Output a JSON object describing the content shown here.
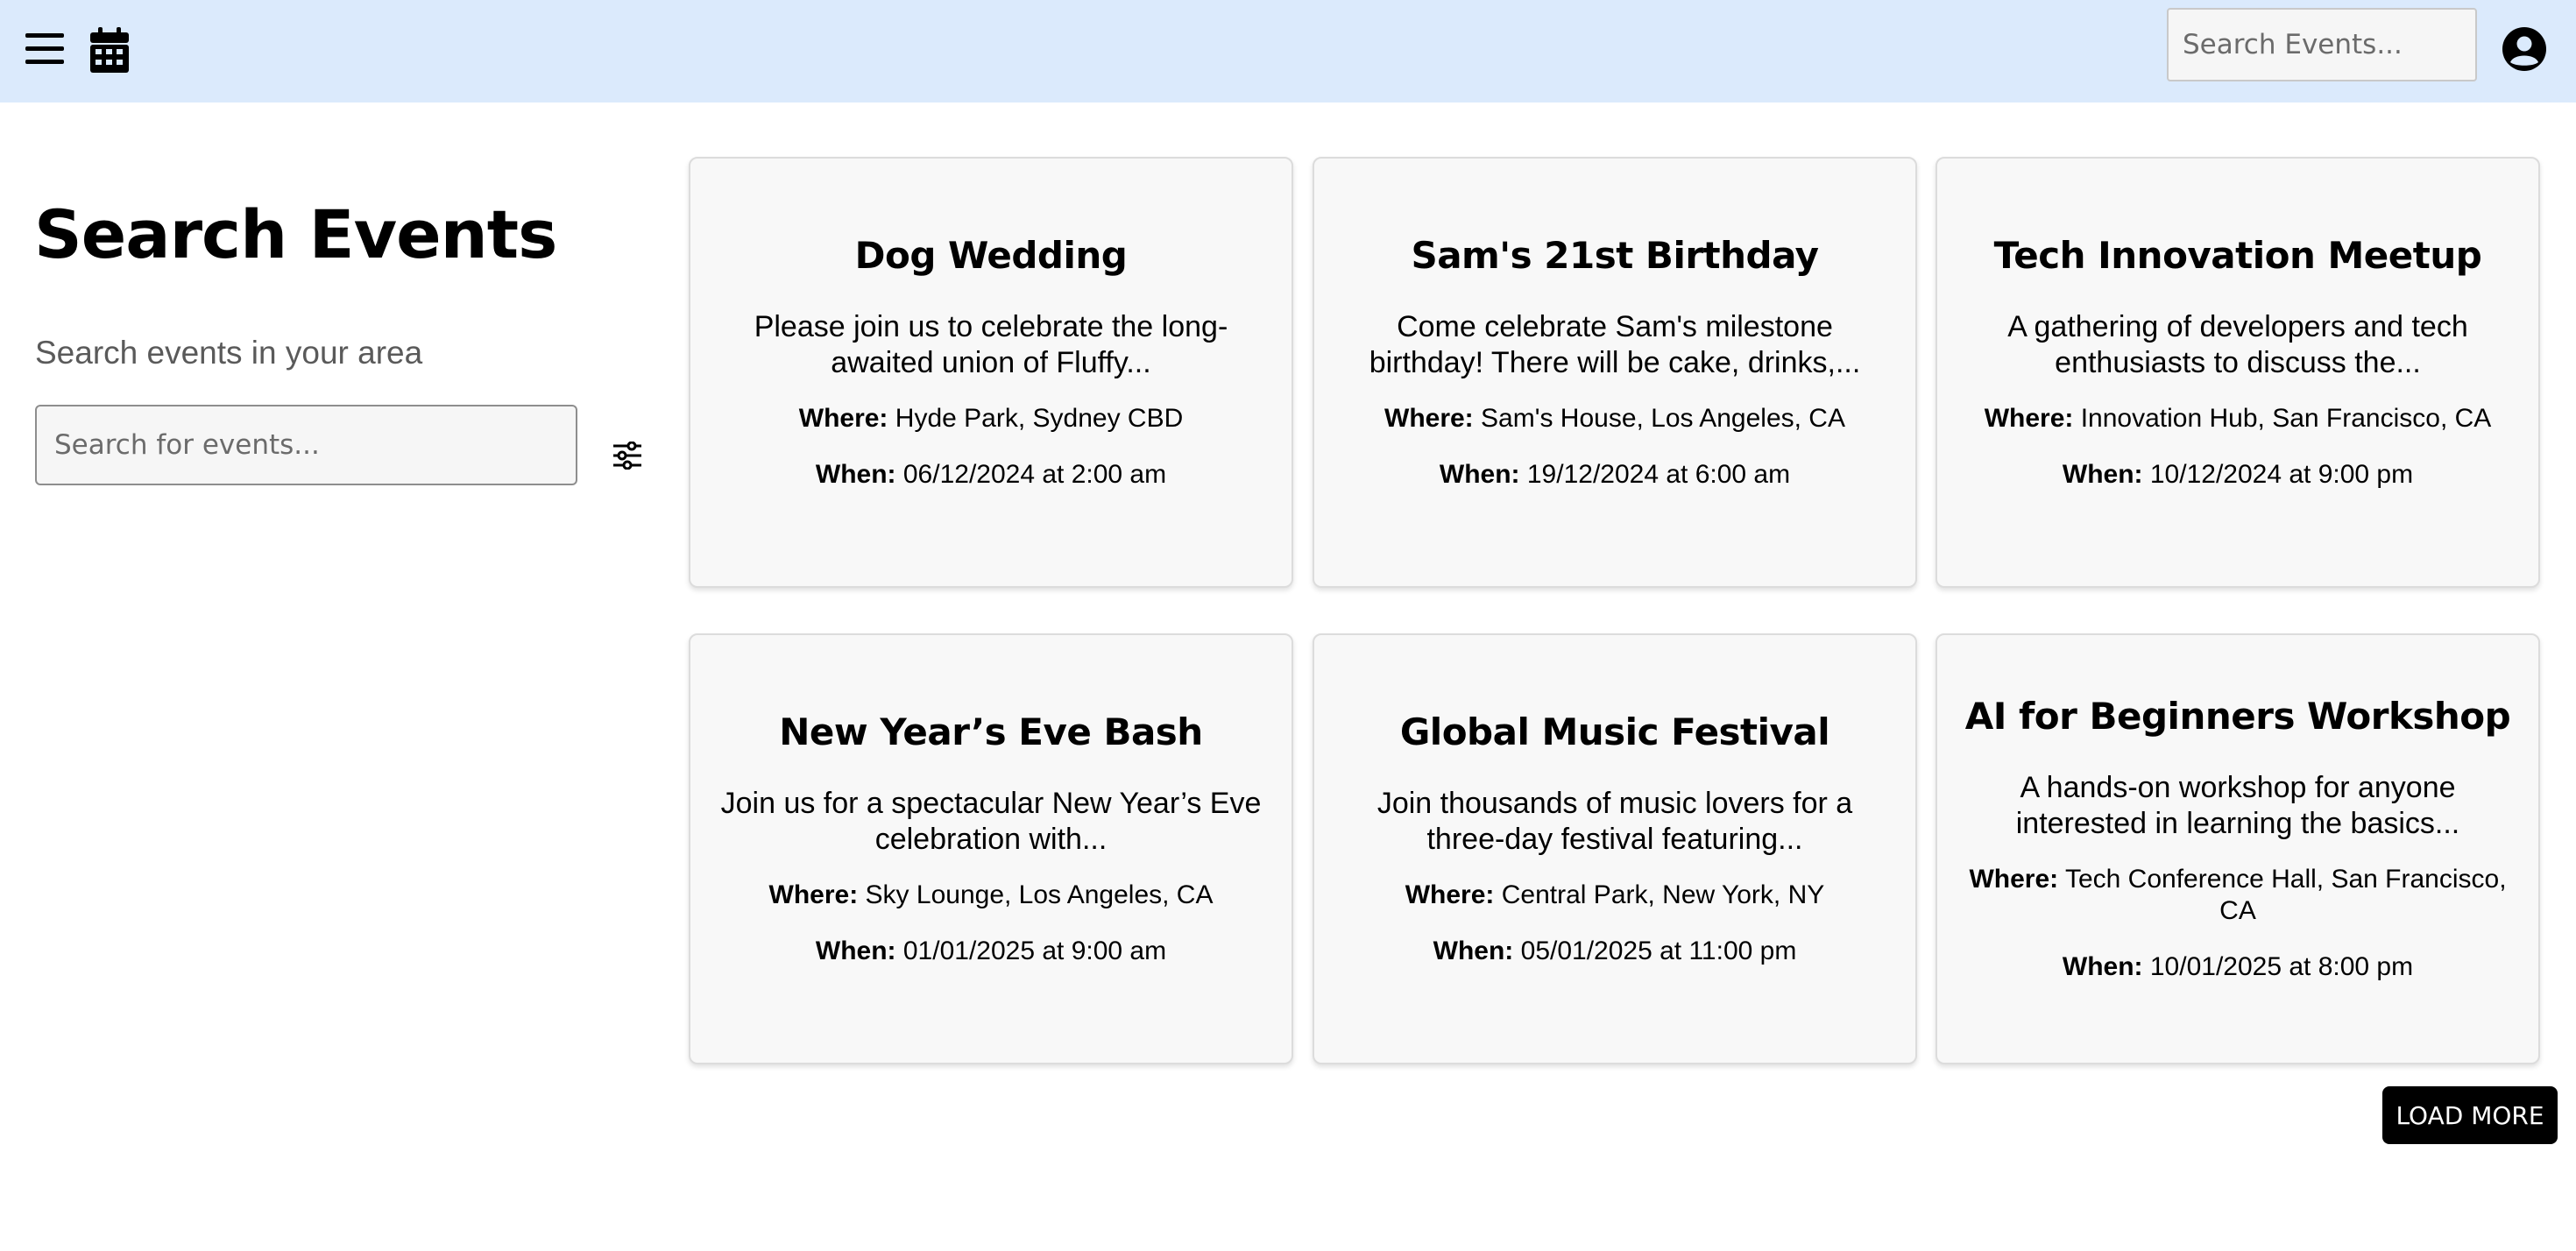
{
  "header": {
    "menu_icon": "hamburger-menu-icon",
    "calendar_icon": "calendar-icon",
    "search_placeholder": "Search Events...",
    "profile_icon": "user-circle-icon"
  },
  "sidebar": {
    "title": "Search Events",
    "subtitle": "Search events in your area",
    "search_placeholder": "Search for events...",
    "filter_icon": "sliders-icon"
  },
  "labels": {
    "where": "Where:",
    "when": "When:"
  },
  "events": [
    {
      "title": "Dog Wedding",
      "description": "Please join us to celebrate the long-awaited union of Fluffy...",
      "where": "Hyde Park, Sydney CBD",
      "when": "06/12/2024 at 2:00 am"
    },
    {
      "title": "Sam's 21st Birthday",
      "description": "Come celebrate Sam's milestone birthday! There will be cake, drinks,...",
      "where": "Sam's House, Los Angeles, CA",
      "when": "19/12/2024 at 6:00 am"
    },
    {
      "title": "Tech Innovation Meetup",
      "description": "A gathering of developers and tech enthusiasts to discuss the...",
      "where": "Innovation Hub, San Francisco, CA",
      "when": "10/12/2024 at 9:00 pm"
    },
    {
      "title": "New Year’s Eve Bash",
      "description": "Join us for a spectacular New Year’s Eve celebration with...",
      "where": "Sky Lounge, Los Angeles, CA",
      "when": "01/01/2025 at 9:00 am"
    },
    {
      "title": "Global Music Festival",
      "description": "Join thousands of music lovers for a three-day festival featuring...",
      "where": "Central Park, New York, NY",
      "when": "05/01/2025 at 11:00 pm"
    },
    {
      "title": "AI for Beginners Workshop",
      "description": "A hands-on workshop for anyone interested in learning the basics...",
      "where": "Tech Conference Hall, San Francisco, CA",
      "when": "10/01/2025 at 8:00 pm"
    }
  ],
  "load_more_label": "LOAD MORE",
  "colors": {
    "header_bg": "#dbeafc",
    "card_bg": "#f8f8f8",
    "button_bg": "#000000"
  }
}
